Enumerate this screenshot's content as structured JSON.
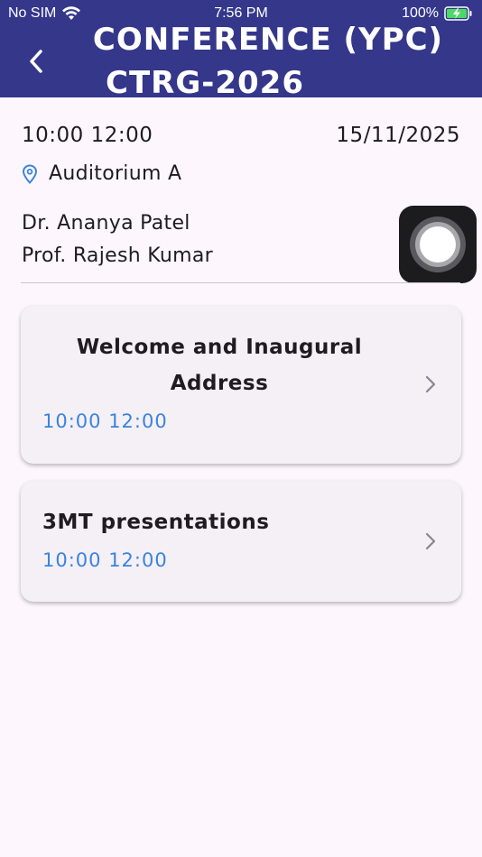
{
  "status_bar": {
    "carrier": "No SIM",
    "time": "7:56 PM",
    "battery": "100%"
  },
  "header": {
    "title_line1": "CONFERENCE (YPC)",
    "title_line2": "CTRG-2026",
    "background_color": "#34378a"
  },
  "session": {
    "time": "10:00 12:00",
    "date": "15/11/2025",
    "location": "Auditorium A",
    "speakers": [
      "Dr. Ananya Patel",
      "Prof. Rajesh Kumar"
    ]
  },
  "items": [
    {
      "title": "Welcome and Inaugural Address",
      "time": "10:00 12:00"
    },
    {
      "title": "3MT presentations",
      "time": "10:00 12:00"
    }
  ],
  "colors": {
    "accent_time": "#3a84dc",
    "location_icon": "#3a84dc",
    "card_bg": "#f4f0f6",
    "page_bg": "#fdf7fd"
  },
  "icons": {
    "back": "chevron-left-icon",
    "location": "location-pin-icon",
    "item_arrow": "chevron-right-icon",
    "assistive": "assistive-touch-icon"
  }
}
